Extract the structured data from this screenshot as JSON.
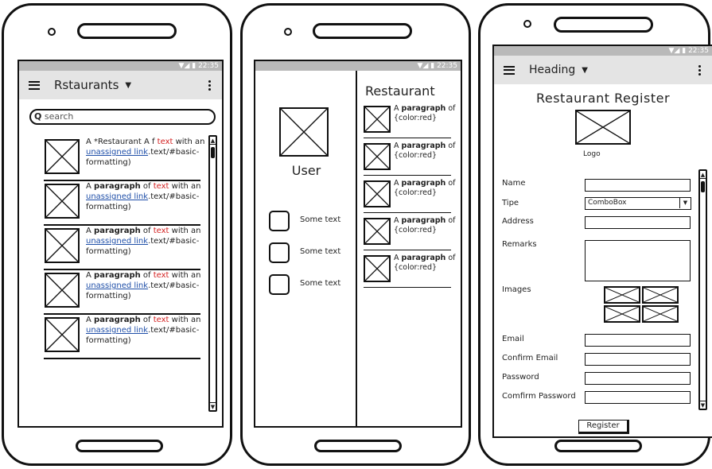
{
  "statusbar": {
    "time": "22:35"
  },
  "screen1": {
    "title": "Rstaurants",
    "search": {
      "placeholder": "search"
    },
    "items": [
      {
        "pre": "A *Restaurant A f ",
        "mid": " with an ",
        "post": ".text/#basic-formatting)",
        "bold": ""
      },
      {
        "pre": "A ",
        "bold": "paragraph",
        "of": " of ",
        "mid": " with an ",
        "post": ".text/#basic-formatting)"
      },
      {
        "pre": "A ",
        "bold": "paragraph",
        "of": " of ",
        "mid": " with an ",
        "post": ".text/#basic-formatting)"
      },
      {
        "pre": "A ",
        "bold": "paragraph",
        "of": " of ",
        "mid": " with an ",
        "post": ".text/#basic-formatting)"
      },
      {
        "pre": "A ",
        "bold": "paragraph",
        "of": " of ",
        "mid": " with an ",
        "post": ".text/#basic-formatting)"
      }
    ],
    "red_word": "text",
    "link_text": "unassigned link"
  },
  "screen2": {
    "user_label": "User",
    "menu_items": [
      "Some text",
      "Some text",
      "Some text"
    ],
    "heading": "Restaurant",
    "list_items": [
      {
        "pre": "A ",
        "bold": "paragraph",
        "post": " of {color:red}"
      },
      {
        "pre": "A ",
        "bold": "paragraph",
        "post": " of {color:red}"
      },
      {
        "pre": "A ",
        "bold": "paragraph",
        "post": " of {color:red}"
      },
      {
        "pre": "A ",
        "bold": "paragraph",
        "post": " of {color:red}"
      },
      {
        "pre": "A ",
        "bold": "paragraph",
        "post": " of {color:red}"
      }
    ]
  },
  "screen3": {
    "appbar_title": "Heading",
    "form_title": "Restaurant Register",
    "logo_label": "Logo",
    "labels": {
      "name": "Name",
      "tipe": "Tipe",
      "address": "Address",
      "remarks": "Remarks",
      "images": "Images",
      "email": "Email",
      "confirm_email": "Confirm Email",
      "password": "Password",
      "confirm_password": "Comfirm Password"
    },
    "combo_value": "ComboBox",
    "register_label": "Register"
  }
}
